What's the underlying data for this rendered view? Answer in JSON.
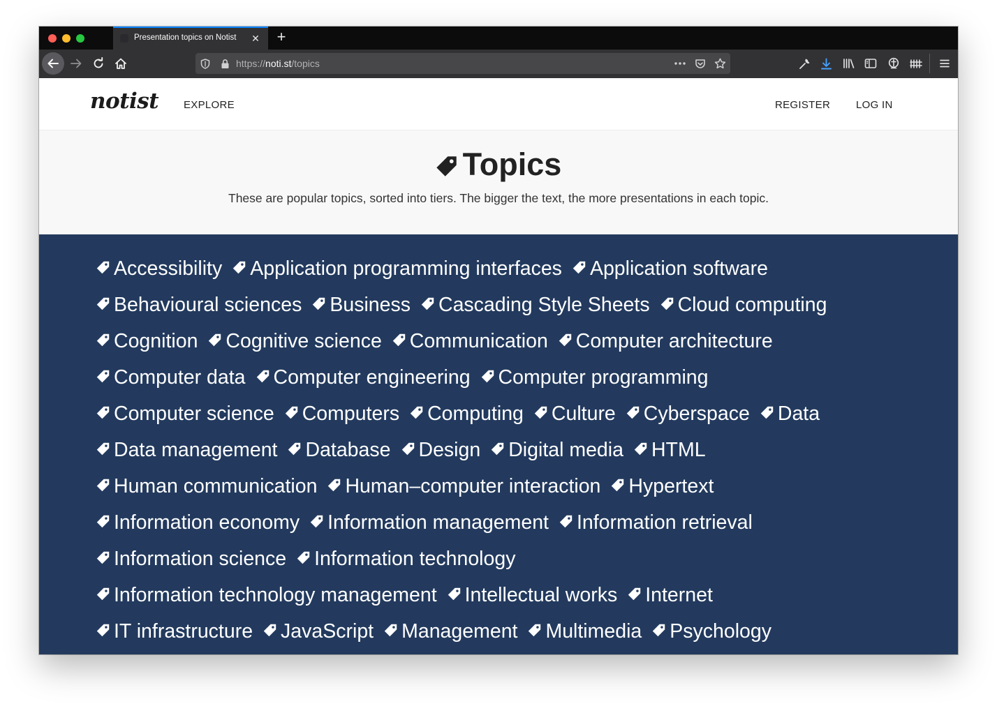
{
  "browser": {
    "tab_title": "Presentation topics on Notist",
    "tab_close": "✕",
    "new_tab": "+",
    "url_scheme": "https://",
    "url_host": "noti.st",
    "url_path": "/topics",
    "accent": "#0a84ff"
  },
  "site": {
    "logo": "notist",
    "nav": {
      "explore": "EXPLORE",
      "register": "REGISTER",
      "login": "LOG IN"
    }
  },
  "hero": {
    "title": "Topics",
    "description": "These are popular topics, sorted into tiers. The bigger the text, the more presentations in each topic."
  },
  "topics_bg": "#233a5e",
  "topics": [
    [
      "Accessibility",
      "Application programming interfaces",
      "Application software"
    ],
    [
      "Behavioural sciences",
      "Business",
      "Cascading Style Sheets",
      "Cloud computing"
    ],
    [
      "Cognition",
      "Cognitive science",
      "Communication",
      "Computer architecture"
    ],
    [
      "Computer data",
      "Computer engineering",
      "Computer programming"
    ],
    [
      "Computer science",
      "Computers",
      "Computing",
      "Culture",
      "Cyberspace",
      "Data"
    ],
    [
      "Data management",
      "Database",
      "Design",
      "Digital media",
      "HTML"
    ],
    [
      "Human communication",
      "Human–computer interaction",
      "Hypertext"
    ],
    [
      "Information economy",
      "Information management",
      "Information retrieval"
    ],
    [
      "Information science",
      "Information technology"
    ],
    [
      "Information technology management",
      "Intellectual works",
      "Internet"
    ],
    [
      "IT infrastructure",
      "JavaScript",
      "Management",
      "Multimedia",
      "Psychology"
    ]
  ]
}
